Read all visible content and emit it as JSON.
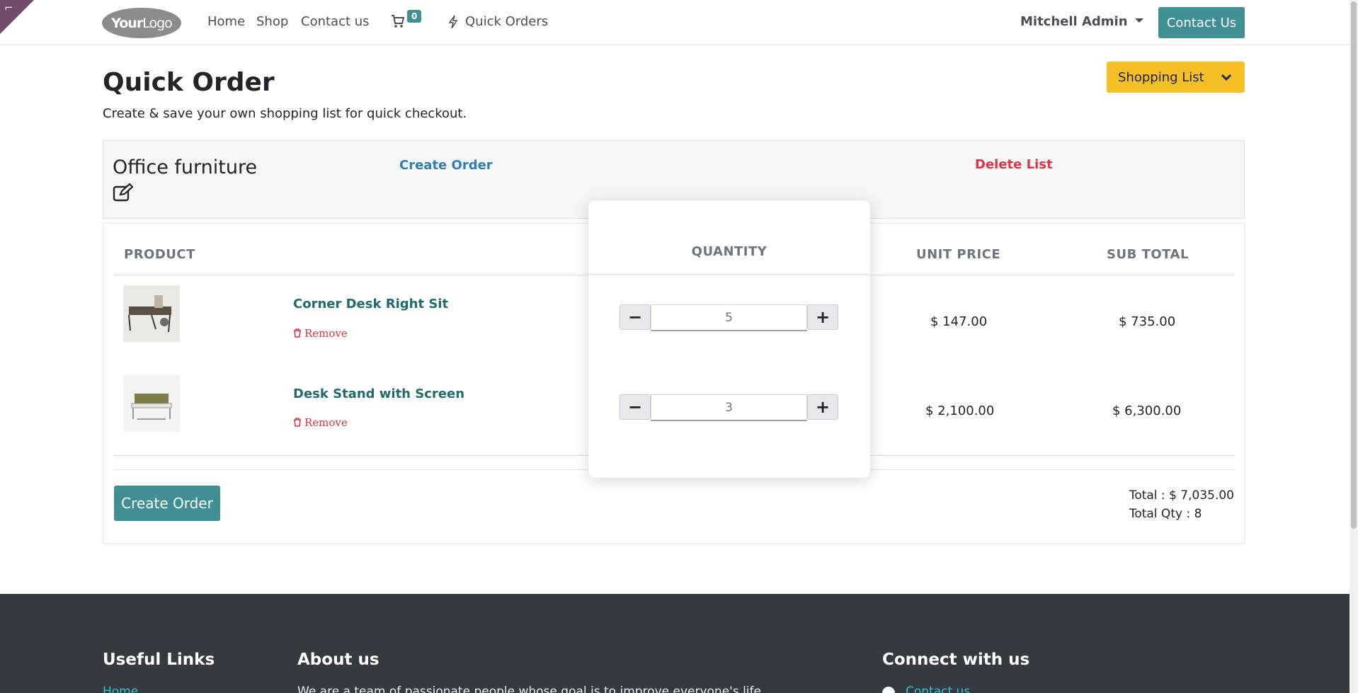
{
  "nav": {
    "logo_part1": "Your",
    "logo_part2": "Logo",
    "home": "Home",
    "shop": "Shop",
    "contact": "Contact us",
    "cart_count": "0",
    "quick_orders": "Quick Orders",
    "user": "Mitchell Admin",
    "contact_button": "Contact Us"
  },
  "page": {
    "title": "Quick Order",
    "subtitle": "Create & save your own shopping list for quick checkout.",
    "shopping_list_button": "Shopping List"
  },
  "list": {
    "name": "Office furniture",
    "create_order_link": "Create Order",
    "delete_link": "Delete List"
  },
  "table": {
    "headers": {
      "product": "PRODUCT",
      "quantity": "QUANTITY",
      "unit_price": "UNIT PRICE",
      "sub_total": "SUB TOTAL"
    },
    "rows": [
      {
        "name": "Corner Desk Right Sit",
        "remove": "Remove",
        "quantity": "5",
        "unit_price": "$ 147.00",
        "sub_total": "$ 735.00"
      },
      {
        "name": "Desk Stand with Screen",
        "remove": "Remove",
        "quantity": "3",
        "unit_price": "$ 2,100.00",
        "sub_total": "$ 6,300.00"
      }
    ],
    "create_order_button": "Create Order",
    "total": "Total : $ 7,035.00",
    "total_qty": "Total Qty : 8"
  },
  "footer": {
    "useful_links": "Useful Links",
    "home_link": "Home",
    "about_us": "About us",
    "about_text": "We are a team of passionate people whose goal is to improve everyone's life",
    "connect": "Connect with us",
    "contact_link": "Contact us"
  },
  "colors": {
    "primary": "#3f8f93",
    "warning": "#f6bf26",
    "danger": "#dc3545",
    "link": "#2e7fb8",
    "footer_bg": "#353a40",
    "corner_ribbon": "#714b67"
  },
  "icons": [
    "cart-icon",
    "bolt-icon",
    "edit-icon",
    "trash-icon",
    "chevron-down-icon",
    "minus-icon",
    "plus-icon"
  ]
}
